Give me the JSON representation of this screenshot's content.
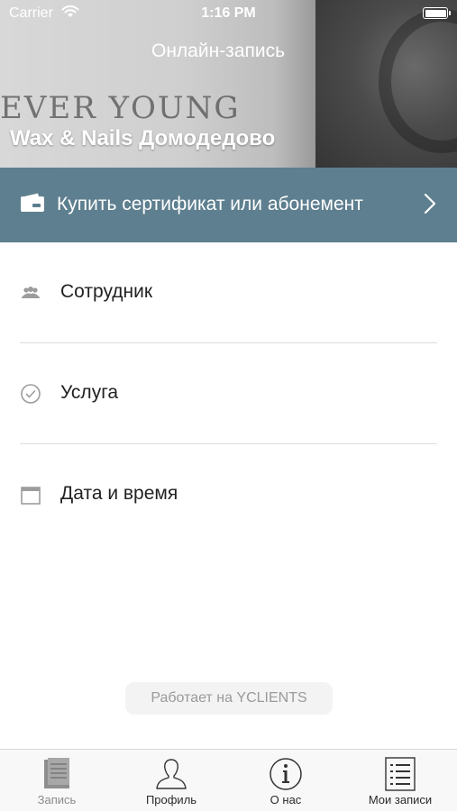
{
  "status_bar": {
    "carrier": "Carrier",
    "time": "1:16 PM"
  },
  "header": {
    "nav_title": "Онлайн-запись",
    "salon_name": "Wax & Nails Домодедово",
    "watermark": "EVER YOUNG"
  },
  "certificate": {
    "label": "Купить сертификат или абонемент",
    "icon": "wallet-icon"
  },
  "booking_steps": [
    {
      "label": "Сотрудник",
      "icon": "people-icon"
    },
    {
      "label": "Услуга",
      "icon": "checkmark-circle-icon"
    },
    {
      "label": "Дата и время",
      "icon": "calendar-icon"
    }
  ],
  "powered_by": "Работает на YCLIENTS",
  "tabs": [
    {
      "label": "Запись",
      "icon": "document-icon",
      "active": true
    },
    {
      "label": "Профиль",
      "icon": "profile-icon",
      "active": false
    },
    {
      "label": "О нас",
      "icon": "info-icon",
      "active": false
    },
    {
      "label": "Мои записи",
      "icon": "list-icon",
      "active": false
    }
  ],
  "colors": {
    "banner": "#5e7f8f",
    "background": "#ffffff"
  }
}
